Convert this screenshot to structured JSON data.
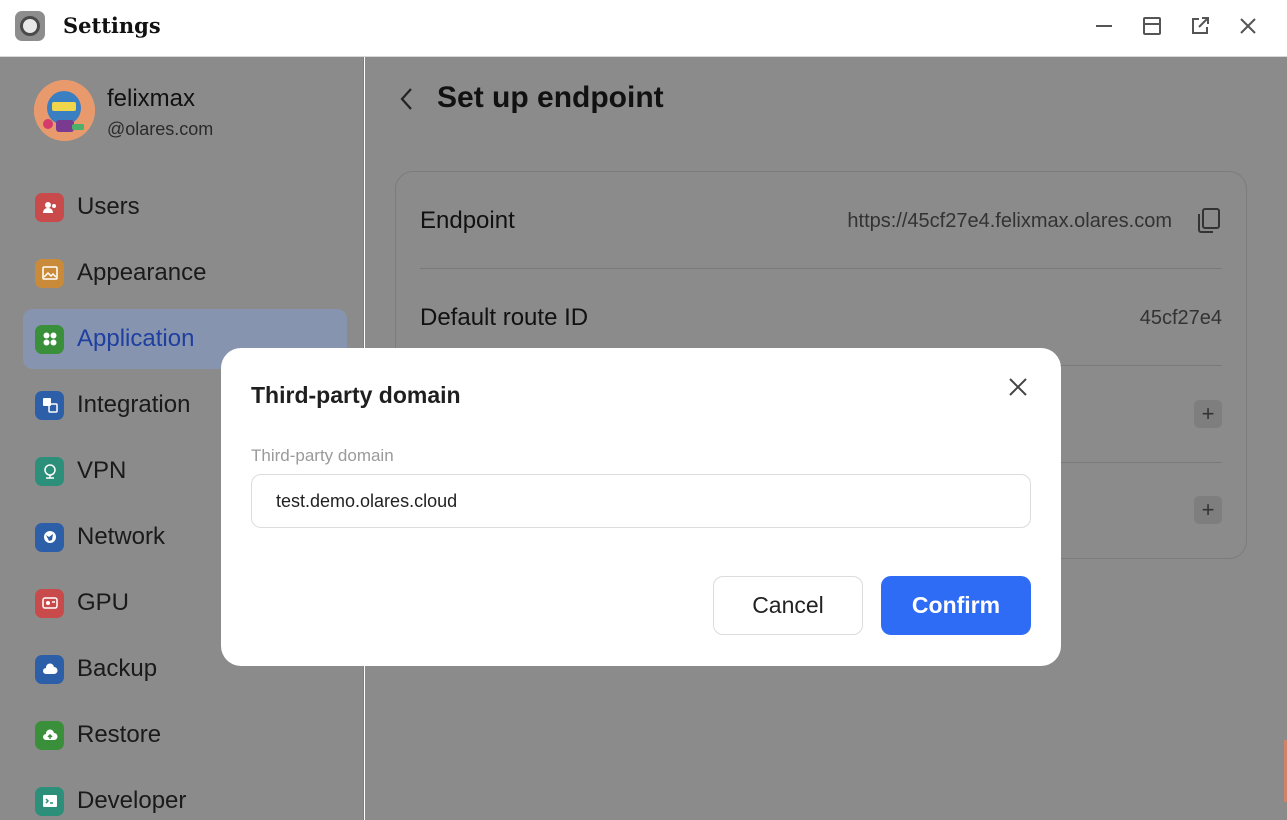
{
  "window": {
    "title": "Settings",
    "controls": [
      "minimize-icon",
      "maximize-icon",
      "external-open-icon",
      "close-icon"
    ]
  },
  "profile": {
    "name": "felixmax",
    "domain": "@olares.com"
  },
  "sidebar": {
    "items": [
      {
        "label": "Users",
        "icon": "users-icon",
        "color": "#c94a4a"
      },
      {
        "label": "Appearance",
        "icon": "image-icon",
        "color": "#c98a3a"
      },
      {
        "label": "Application",
        "icon": "apps-icon",
        "color": "#3a8f3a",
        "active": true
      },
      {
        "label": "Integration",
        "icon": "integration-icon",
        "color": "#2c5fa8"
      },
      {
        "label": "VPN",
        "icon": "vpn-icon",
        "color": "#2b8f7a"
      },
      {
        "label": "Network",
        "icon": "network-icon",
        "color": "#2c5fa8"
      },
      {
        "label": "GPU",
        "icon": "gpu-icon",
        "color": "#c94a4a"
      },
      {
        "label": "Backup",
        "icon": "cloud-icon",
        "color": "#2c5fa8"
      },
      {
        "label": "Restore",
        "icon": "cloud-upload-icon",
        "color": "#3a8f3a"
      },
      {
        "label": "Developer",
        "icon": "terminal-icon",
        "color": "#2b8f7a"
      }
    ]
  },
  "main": {
    "title": "Set up endpoint",
    "rows": [
      {
        "label": "Endpoint",
        "value": "https://45cf27e4.felixmax.olares.com"
      },
      {
        "label": "Default route ID",
        "value": "45cf27e4"
      }
    ]
  },
  "dialog": {
    "title": "Third-party domain",
    "field_label": "Third-party domain",
    "field_value": "test.demo.olares.cloud",
    "cancel_label": "Cancel",
    "confirm_label": "Confirm",
    "confirm_color": "#2f6cf5"
  }
}
